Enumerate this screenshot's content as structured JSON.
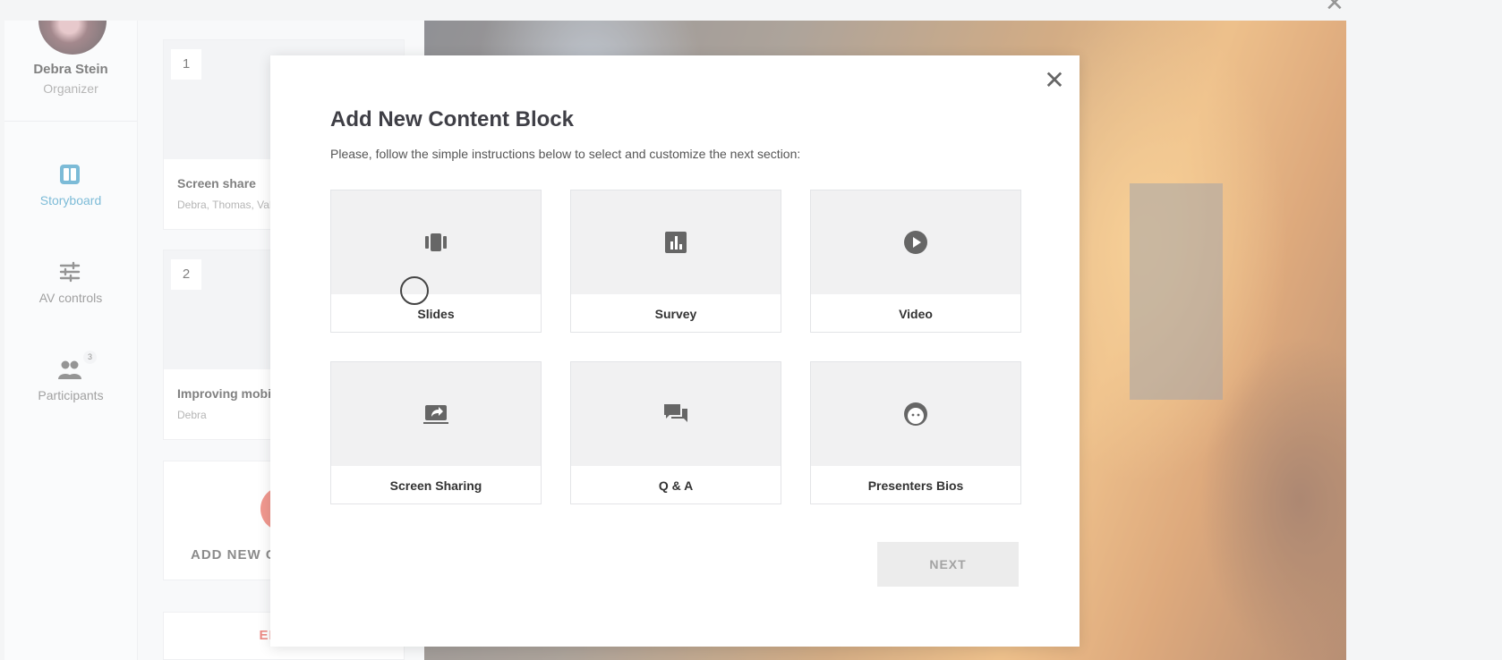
{
  "window": {
    "close_glyph": "✕"
  },
  "sidebar": {
    "user": {
      "name": "Debra Stein",
      "role": "Organizer"
    },
    "items": [
      {
        "label": "Storyboard",
        "icon": "storyboard-icon",
        "active": true
      },
      {
        "label": "AV controls",
        "icon": "sliders-icon",
        "active": false
      },
      {
        "label": "Participants",
        "icon": "people-icon",
        "badge": "3",
        "active": false
      }
    ],
    "accent_color": "#2d92bf"
  },
  "storyboard": {
    "cards": [
      {
        "number": "1",
        "title": "Screen share",
        "meta": "Debra, Thomas, Vale"
      },
      {
        "number": "2",
        "title": "Improving mobile",
        "meta": "Debra"
      }
    ],
    "add_label": "ADD NEW CO",
    "end_label": "END W",
    "add_color": "#e8594b"
  },
  "modal": {
    "title": "Add New Content Block",
    "subtitle": "Please, follow the simple instructions below to select and customize the next section:",
    "close_glyph": "✕",
    "options": [
      {
        "label": "Slides",
        "icon": "slides-icon"
      },
      {
        "label": "Survey",
        "icon": "survey-chart-icon"
      },
      {
        "label": "Video",
        "icon": "play-icon"
      },
      {
        "label": "Screen Sharing",
        "icon": "screen-share-icon"
      },
      {
        "label": "Q & A",
        "icon": "chat-bubbles-icon"
      },
      {
        "label": "Presenters Bios",
        "icon": "face-icon"
      }
    ],
    "next_label": "NEXT"
  }
}
